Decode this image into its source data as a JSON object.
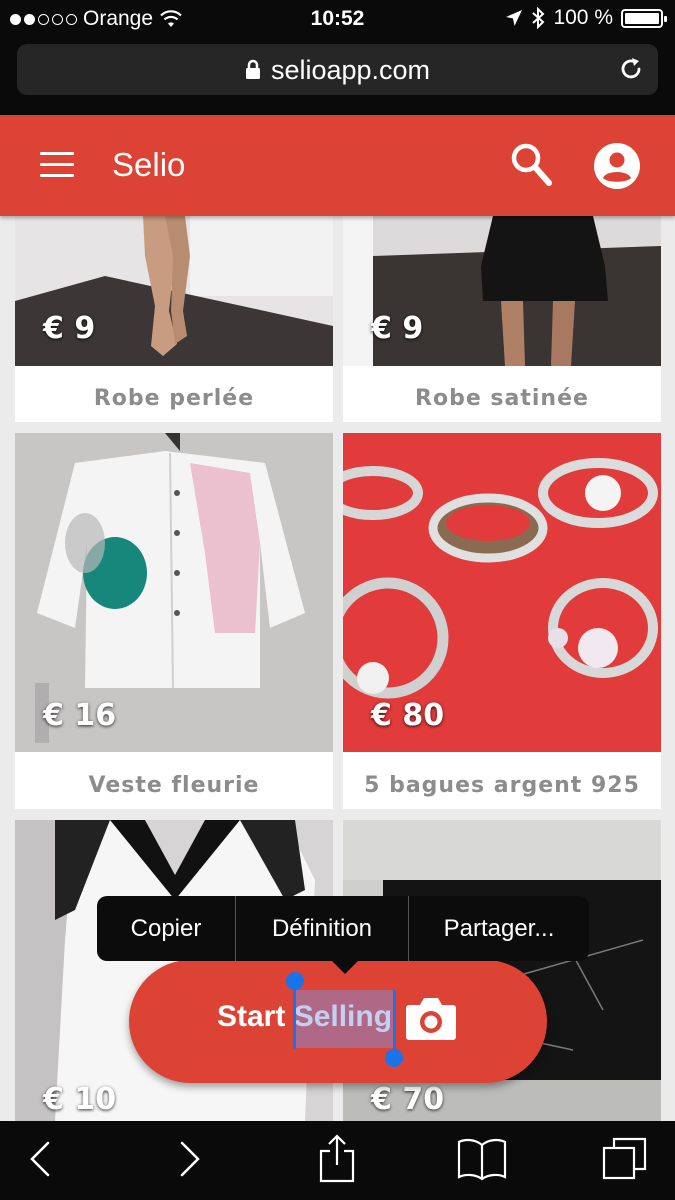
{
  "status_bar": {
    "carrier": "Orange",
    "time": "10:52",
    "battery": "100 %"
  },
  "browser": {
    "url": "selioapp.com"
  },
  "app_bar": {
    "title": "Selio"
  },
  "listings": [
    {
      "price": "€ 9",
      "title": "Robe perlée"
    },
    {
      "price": "€ 9",
      "title": "Robe satinée"
    },
    {
      "price": "€ 16",
      "title": "Veste fleurie"
    },
    {
      "price": "€ 80",
      "title": "5 bagues argent 925"
    },
    {
      "price": "€ 10",
      "title": ""
    },
    {
      "price": "€ 70",
      "title": ""
    }
  ],
  "cta": {
    "label_start": "Start ",
    "label_selected": "Selling"
  },
  "context_menu": {
    "items": [
      "Copier",
      "Définition",
      "Partager..."
    ]
  },
  "colors": {
    "brand": "#dc4335",
    "selection": "#1a73e8"
  }
}
